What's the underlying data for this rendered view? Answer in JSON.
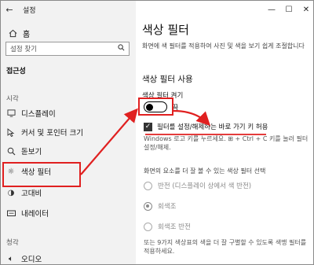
{
  "window": {
    "app_title": "설정",
    "back_icon": "back-arrow-icon"
  },
  "sidebar": {
    "home_label": "홈",
    "search_placeholder": "설정 찾기",
    "section_title": "접근성",
    "group_vision": "시각",
    "items": [
      {
        "label": "디스플레이",
        "icon": "display-icon"
      },
      {
        "label": "커서 및 포인터 크기",
        "icon": "cursor-icon"
      },
      {
        "label": "돋보기",
        "icon": "magnifier-icon"
      },
      {
        "label": "색상 필터",
        "icon": "color-filter-icon"
      },
      {
        "label": "고대비",
        "icon": "contrast-icon"
      },
      {
        "label": "내레이터",
        "icon": "narrator-icon"
      }
    ],
    "group_hearing": "청각",
    "item_audio": "오디오"
  },
  "content": {
    "title": "색상 필터",
    "description": "화면에 색 필터를 적용하여 사진 및 색을 보기 쉽게 조절합니다",
    "subhead": "색상 필터 사용",
    "toggle_label": "색상 필터 켜기",
    "toggle_state": "끔",
    "toggle_on": false,
    "shortcut_label": "필터를 설정/해제하는 바로 가기 키 허용",
    "shortcut_checked": true,
    "shortcut_hint": "Windows 로고 키를 누르세요. ⊞ + Ctrl + C 키를 눌러 필터 설정/해제.",
    "filter_prompt": "화면의 요소를 더 잘 볼 수 있는 색상 필터 선택",
    "filters": [
      {
        "label": "반전 (디스플레이 상에서 색 반전)",
        "selected": false
      },
      {
        "label": "회색조",
        "selected": true
      },
      {
        "label": "회색조 반전",
        "selected": false
      }
    ],
    "footer_text": "또는 9가지 색상표의 색을 더 잘 구별할 수 있도록 색맹 필터를 적용하세요."
  },
  "colors": {
    "annotation_red": "#e02020",
    "sidebar_bg": "#f2f2f2"
  }
}
